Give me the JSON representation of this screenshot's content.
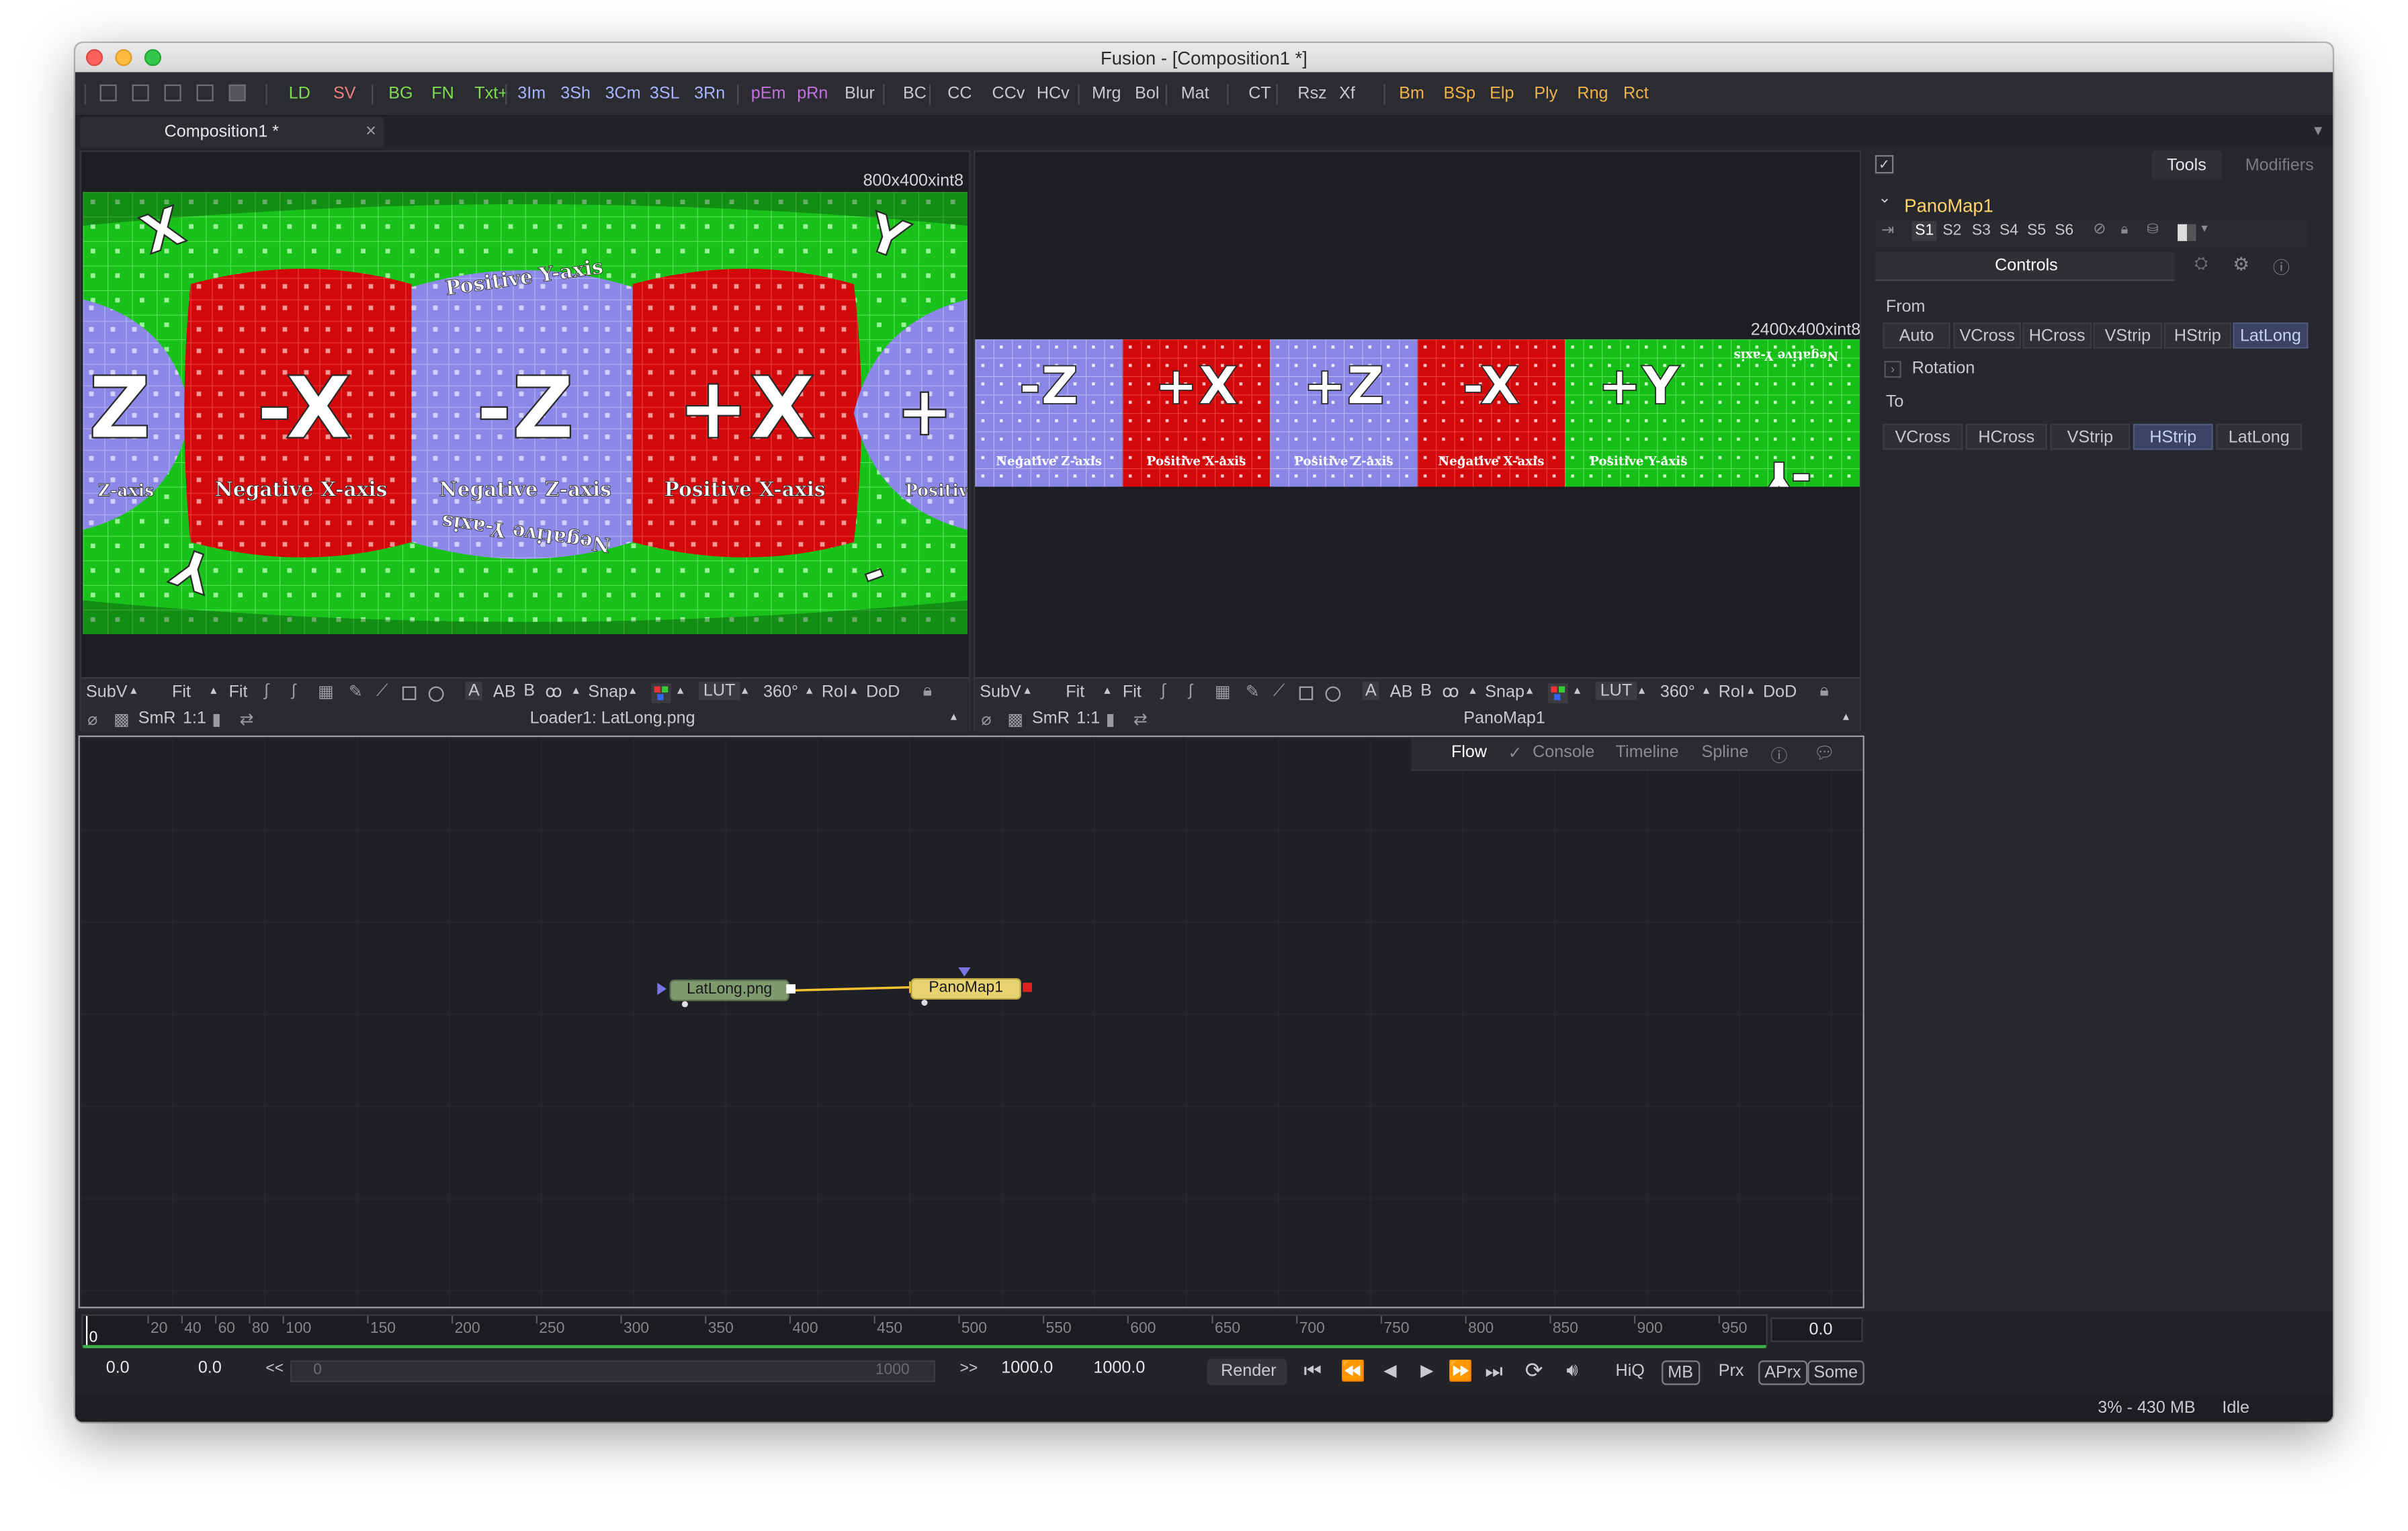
{
  "window": {
    "title": "Fusion - [Composition1 *]"
  },
  "colors": {
    "accent": "#ffd36a",
    "blue_select": "#3b4262",
    "green_toolbar": "#7fdc54",
    "purple_toolbar": "#c46ee2"
  },
  "toolbar": {
    "items": [
      {
        "label": "LD",
        "color": "#7fdc54"
      },
      {
        "label": "SV",
        "color": "#f07f7f"
      },
      {
        "label": "BG",
        "color": "#7fdc54"
      },
      {
        "label": "FN",
        "color": "#7fdc54"
      },
      {
        "label": "Txt+",
        "color": "#7fdc54"
      },
      {
        "label": "3Im",
        "color": "#a9b3ff"
      },
      {
        "label": "3Sh",
        "color": "#a9b3ff"
      },
      {
        "label": "3Cm",
        "color": "#a9b3ff"
      },
      {
        "label": "3SL",
        "color": "#a9b3ff"
      },
      {
        "label": "3Rn",
        "color": "#a9b3ff"
      },
      {
        "label": "pEm",
        "color": "#c46ee2"
      },
      {
        "label": "pRn",
        "color": "#c46ee2"
      },
      {
        "label": "Blur",
        "color": "#c8c9ce"
      },
      {
        "label": "BC",
        "color": "#c8c9ce"
      },
      {
        "label": "CC",
        "color": "#c8c9ce"
      },
      {
        "label": "CCv",
        "color": "#c8c9ce"
      },
      {
        "label": "HCv",
        "color": "#c8c9ce"
      },
      {
        "label": "Mrg",
        "color": "#c8c9ce"
      },
      {
        "label": "Bol",
        "color": "#c8c9ce"
      },
      {
        "label": "Mat",
        "color": "#c8c9ce"
      },
      {
        "label": "CT",
        "color": "#c8c9ce"
      },
      {
        "label": "Rsz",
        "color": "#c8c9ce"
      },
      {
        "label": "Xf",
        "color": "#c8c9ce"
      },
      {
        "label": "Bm",
        "color": "#f0b24a"
      },
      {
        "label": "BSp",
        "color": "#f0b24a"
      },
      {
        "label": "Elp",
        "color": "#f0b24a"
      },
      {
        "label": "Ply",
        "color": "#f0b24a"
      },
      {
        "label": "Rng",
        "color": "#f0b24a"
      },
      {
        "label": "Rct",
        "color": "#f0b24a"
      }
    ]
  },
  "tab": {
    "label": "Composition1 *"
  },
  "viewer_left": {
    "resolution": "800x400xint8",
    "label": "Loader1: LatLong.png",
    "faces": [
      "Z",
      "-X",
      "-Z",
      "+X",
      "+"
    ],
    "captions": [
      "Negative X-axis",
      "Negative Z-axis",
      "Positive X-axis",
      "Positive Y-axis",
      "Negative Y-axis",
      "Z-axis",
      "Positiv"
    ],
    "bar": {
      "subv": "SubV",
      "fit1": "Fit",
      "fit2": "Fit",
      "snap": "Snap",
      "lut": "LUT",
      "deg": "360°",
      "roi": "RoI",
      "dod": "DoD",
      "smr": "SmR",
      "ratio": "1:1"
    }
  },
  "viewer_right": {
    "resolution": "2400x400xint8",
    "label": "PanoMap1",
    "tiles": [
      {
        "face": "-Z",
        "caption": "Negative Z-axis"
      },
      {
        "face": "+X",
        "caption": "Positive X-axis"
      },
      {
        "face": "+Z",
        "caption": "Positive Z-axis"
      },
      {
        "face": "-X",
        "caption": "Negative X-axis"
      },
      {
        "face": "+Y",
        "caption": "Positive Y-axis"
      },
      {
        "face": "-Y",
        "caption": "Negative Y-axis"
      }
    ],
    "bar": {
      "subv": "SubV",
      "fit1": "Fit",
      "fit2": "Fit",
      "snap": "Snap",
      "lut": "LUT",
      "deg": "360°",
      "roi": "RoI",
      "dod": "DoD",
      "smr": "SmR",
      "ratio": "1:1"
    }
  },
  "flow": {
    "tabs": [
      "Flow",
      "Console",
      "Timeline",
      "Spline"
    ],
    "nodes": {
      "loader": "LatLong.png",
      "panomap": "PanoMap1"
    }
  },
  "panel": {
    "tabs": {
      "tools": "Tools",
      "modifiers": "Modifiers"
    },
    "node_name": "PanoMap1",
    "slots": [
      "S1",
      "S2",
      "S3",
      "S4",
      "S5",
      "S6"
    ],
    "controls_tab": "Controls",
    "from_label": "From",
    "from_options": [
      "Auto",
      "VCross",
      "HCross",
      "VStrip",
      "HStrip",
      "LatLong"
    ],
    "from_selected": "LatLong",
    "rotation_label": "Rotation",
    "to_label": "To",
    "to_options": [
      "VCross",
      "HCross",
      "VStrip",
      "HStrip",
      "LatLong"
    ],
    "to_selected": "HStrip"
  },
  "timeline": {
    "ticks": [
      "0",
      "20",
      "40",
      "60",
      "80",
      "100",
      "150",
      "200",
      "250",
      "300",
      "350",
      "400",
      "450",
      "500",
      "550",
      "600",
      "650",
      "700",
      "750",
      "800",
      "850",
      "900",
      "950"
    ],
    "current_frame": "0.0",
    "start": "0.0",
    "global_start": "0.0",
    "range_back": "<<",
    "range_start": "0",
    "range_end": "1000",
    "range_fwd": ">>",
    "end": "1000.0",
    "global_end": "1000.0",
    "render": "Render",
    "hiq": "HiQ",
    "mb": "MB",
    "prx": "Prx",
    "aprx": "APrx",
    "some": "Some"
  },
  "status": {
    "memory": "3% - 430 MB",
    "state": "Idle"
  }
}
